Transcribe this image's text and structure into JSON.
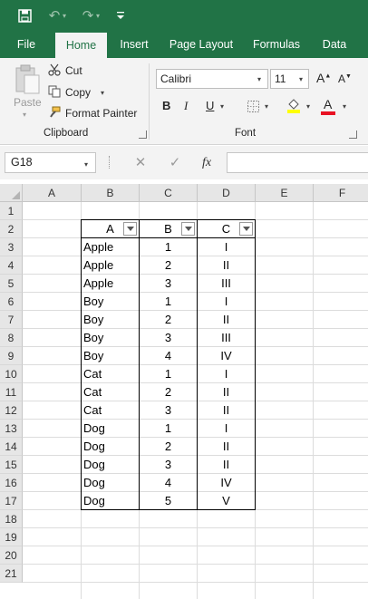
{
  "title_bar": {
    "icons": [
      "save-icon",
      "undo-icon",
      "redo-icon",
      "customize-qat-icon"
    ]
  },
  "ribbon_tabs": [
    "File",
    "Home",
    "Insert",
    "Page Layout",
    "Formulas",
    "Data"
  ],
  "active_tab": "Home",
  "clipboard": {
    "paste_label": "Paste",
    "cut_label": "Cut",
    "copy_label": "Copy",
    "format_painter_label": "Format Painter",
    "group_label": "Clipboard"
  },
  "font": {
    "font_name": "Calibri",
    "font_size": "11",
    "group_label": "Font",
    "bold": "B",
    "italic": "I",
    "underline": "U",
    "grow": "A",
    "shrink": "A",
    "font_color_letter": "A"
  },
  "formula_bar": {
    "name_box": "G18",
    "cancel": "✕",
    "enter": "✓",
    "fx": "fx",
    "value": ""
  },
  "columns": [
    "A",
    "B",
    "C",
    "D",
    "E",
    "F"
  ],
  "rows": [
    "1",
    "2",
    "3",
    "4",
    "5",
    "6",
    "7",
    "8",
    "9",
    "10",
    "11",
    "12",
    "13",
    "14",
    "15",
    "16",
    "17",
    "18",
    "19",
    "20",
    "21"
  ],
  "table": {
    "headers": [
      "A",
      "B",
      "C"
    ],
    "rows": [
      [
        "Apple",
        "1",
        "I"
      ],
      [
        "Apple",
        "2",
        "II"
      ],
      [
        "Apple",
        "3",
        "III"
      ],
      [
        "Boy",
        "1",
        "I"
      ],
      [
        "Boy",
        "2",
        "II"
      ],
      [
        "Boy",
        "3",
        "III"
      ],
      [
        "Boy",
        "4",
        "IV"
      ],
      [
        "Cat",
        "1",
        "I"
      ],
      [
        "Cat",
        "2",
        "II"
      ],
      [
        "Cat",
        "3",
        "II"
      ],
      [
        "Dog",
        "1",
        "I"
      ],
      [
        "Dog",
        "2",
        "II"
      ],
      [
        "Dog",
        "3",
        "II"
      ],
      [
        "Dog",
        "4",
        "IV"
      ],
      [
        "Dog",
        "5",
        "V"
      ]
    ]
  },
  "colors": {
    "accent": "#217346",
    "font_color_bar": "#e81123",
    "highlight_bar": "#ffff00"
  }
}
